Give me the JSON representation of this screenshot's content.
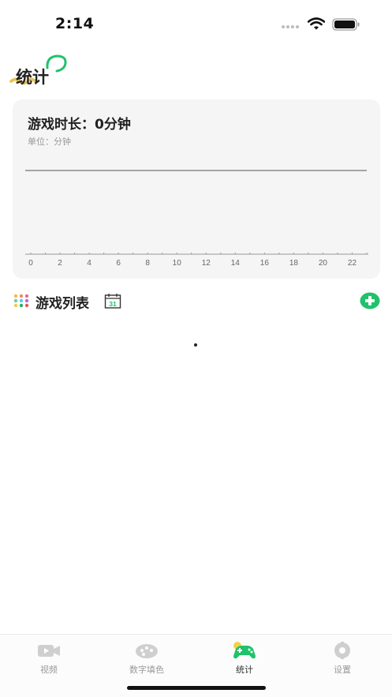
{
  "status_bar": {
    "time": "2:14"
  },
  "page": {
    "title": "统计"
  },
  "stats": {
    "title": "游戏时长：0分钟",
    "unit": "单位：分钟"
  },
  "chart_data": {
    "type": "line",
    "title": "游戏时长：0分钟",
    "subtitle": "单位：分钟",
    "x": [
      0,
      2,
      4,
      6,
      8,
      10,
      12,
      14,
      16,
      18,
      20,
      22
    ],
    "x_tick_labels": [
      "0",
      "2",
      "4",
      "6",
      "8",
      "10",
      "12",
      "14",
      "16",
      "18",
      "20",
      "22"
    ],
    "series": [
      {
        "values": []
      }
    ],
    "xlim": [
      0,
      23
    ],
    "grid": false,
    "colors": {
      "axis": "#999999",
      "top_line": "#555555"
    }
  },
  "game_list": {
    "title": "游戏列表",
    "calendar_label": "31"
  },
  "tabs": [
    {
      "label": "视频",
      "icon": "video-camera-icon",
      "active": false
    },
    {
      "label": "数字填色",
      "icon": "palette-icon",
      "active": false
    },
    {
      "label": "统计",
      "icon": "gamepad-icon",
      "active": true
    },
    {
      "label": "设置",
      "icon": "settings-icon",
      "active": false
    }
  ],
  "colors": {
    "accent_green": "#1fc26b",
    "card_bg": "#f5f5f5",
    "deco_yellow": "#e8c04a"
  }
}
